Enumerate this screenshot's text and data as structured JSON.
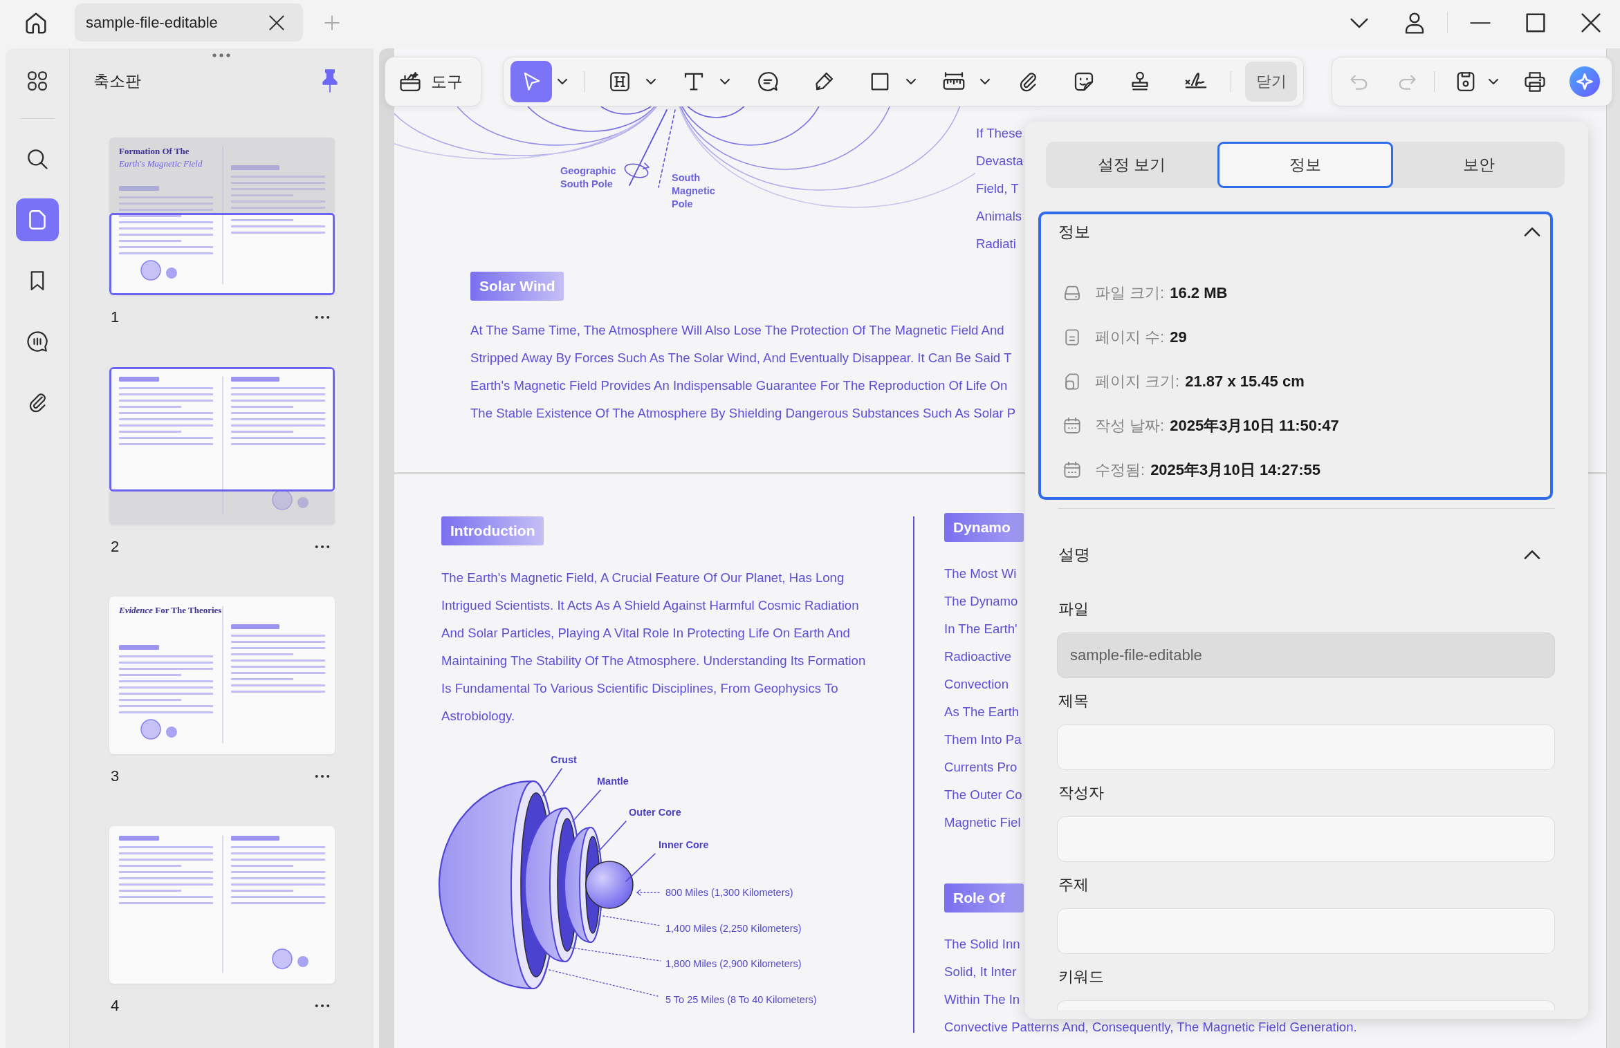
{
  "window": {
    "tabs": [
      {
        "label": "sample-file-editable",
        "selected": true
      }
    ]
  },
  "nav_rail": [
    {
      "kind": "thumbnails",
      "selected": false
    },
    {
      "kind": "search",
      "selected": false
    },
    {
      "kind": "pages",
      "selected": true
    },
    {
      "kind": "bookmarks",
      "selected": false
    },
    {
      "kind": "comments",
      "selected": false
    },
    {
      "kind": "attachments",
      "selected": false
    }
  ],
  "thumbnail_panel": {
    "title": "축소판",
    "pinned": true,
    "pages": [
      {
        "number": "1",
        "kind": "lower",
        "title": "Formation Of The",
        "subtitle": "Earth's Magnetic Field"
      },
      {
        "number": "2",
        "kind": "upper"
      },
      {
        "number": "3",
        "kind": "plain",
        "title": "*Evidence* For The Theories"
      },
      {
        "number": "4",
        "kind": "plain"
      }
    ]
  },
  "toolbar": {
    "tools_button": {
      "label": "도구"
    },
    "tools": [
      {
        "kind": "select",
        "selected": true,
        "has_menu": true
      },
      {
        "kind": "heading",
        "selected": false,
        "has_menu": true
      },
      {
        "kind": "text",
        "selected": false,
        "has_menu": true
      },
      {
        "kind": "comment",
        "selected": false,
        "has_menu": false
      },
      {
        "kind": "pencil",
        "selected": false,
        "has_menu": false
      },
      {
        "kind": "shape",
        "selected": false,
        "has_menu": true
      },
      {
        "kind": "measure",
        "selected": false,
        "has_menu": true
      },
      {
        "kind": "attachment",
        "selected": false,
        "has_menu": false
      },
      {
        "kind": "sticker",
        "selected": false,
        "has_menu": false
      },
      {
        "kind": "stamp",
        "selected": false,
        "has_menu": false
      },
      {
        "kind": "signature",
        "selected": false,
        "has_menu": false
      }
    ],
    "close_button": {
      "label": "닫기"
    },
    "actions": [
      {
        "kind": "undo",
        "disabled": true,
        "has_menu": false
      },
      {
        "kind": "redo",
        "disabled": true,
        "has_menu": false
      },
      {
        "kind": "save",
        "disabled": false,
        "has_menu": true
      },
      {
        "kind": "print",
        "disabled": false,
        "has_menu": false
      },
      {
        "kind": "ai_assistant",
        "disabled": false,
        "has_menu": false
      }
    ]
  },
  "document": {
    "upper_page": {
      "diagram_labels": [
        "Geographic South Pole",
        "South Magnetic Pole"
      ],
      "side_lines": [
        "If These",
        "Devasta",
        "Field, T",
        "Animals",
        "Radiati"
      ],
      "section": {
        "heading": "Solar Wind",
        "lines": [
          "At The Same Time, The Atmosphere Will Also Lose The Protection Of The Magnetic Field And",
          "Stripped Away By Forces Such As The Solar Wind, And Eventually Disappear. It Can Be Said T",
          "Earth's Magnetic Field Provides An Indispensable Guarantee For The Reproduction Of Life On",
          "The Stable Existence Of The Atmosphere By Shielding Dangerous Substances Such As Solar P"
        ]
      }
    },
    "lower_page": {
      "left": {
        "heading": "Introduction",
        "lines": [
          "The Earth's Magnetic Field, A Crucial Feature Of Our Planet, Has Long",
          "Intrigued Scientists. It Acts As A Shield Against Harmful Cosmic Radiation",
          "And Solar Particles, Playing A Vital Role In Protecting Life On Earth And",
          "Maintaining The Stability Of The Atmosphere. Understanding Its Formation",
          "Is Fundamental To Various Scientific Disciplines, From Geophysics To",
          "Astrobiology."
        ],
        "figure": {
          "layer_labels": [
            "Crust",
            "Mantle",
            "Outer Core",
            "Inner Core"
          ],
          "depth_labels": [
            "800 Miles (1,300 Kilometers)",
            "1,400 Miles (2,250 Kilometers)",
            "1,800 Miles (2,900 Kilometers)",
            "5 To 25 Miles (8 To 40 Kilometers)"
          ]
        }
      },
      "right": [
        {
          "heading": "Dynamo",
          "lines": [
            "The Most Wi",
            "The Dynamo",
            "In The Earth'",
            "Radioactive",
            "Convection",
            "As The Earth",
            "Them Into Pa",
            "Currents Pro",
            "The Outer Co",
            "Magnetic Fiel"
          ]
        },
        {
          "heading": "Role Of",
          "lines": [
            "The Solid Inn",
            "Solid, It Inter",
            "Within The In",
            "Convective Patterns And, Consequently, The Magnetic Field Generation."
          ]
        }
      ]
    }
  },
  "properties_panel": {
    "tabs": [
      {
        "label": "설정 보기",
        "selected": false
      },
      {
        "label": "정보",
        "selected": true
      },
      {
        "label": "보안",
        "selected": false
      }
    ],
    "info_section": {
      "title": "정보",
      "expanded": true,
      "focused": true,
      "rows": [
        {
          "kind": "file_size",
          "label": "파일 크기:",
          "value": "16.2 MB"
        },
        {
          "kind": "page_count",
          "label": "페이지 수:",
          "value": "29"
        },
        {
          "kind": "page_size",
          "label": "페이지 크기:",
          "value": "21.87 x 15.45 cm"
        },
        {
          "kind": "created",
          "label": "작성 날짜:",
          "value": "2025年3月10日 11:50:47"
        },
        {
          "kind": "modified",
          "label": "수정됨:",
          "value": "2025年3月10日 14:27:55"
        }
      ]
    },
    "description_section": {
      "title": "설명",
      "expanded": true,
      "fields": [
        {
          "label": "파일",
          "value": "sample-file-editable",
          "disabled": true
        },
        {
          "label": "제목",
          "disabled": false
        },
        {
          "label": "작성자",
          "disabled": false
        },
        {
          "label": "주제",
          "disabled": false
        },
        {
          "label": "키워드",
          "disabled": false
        }
      ]
    }
  }
}
